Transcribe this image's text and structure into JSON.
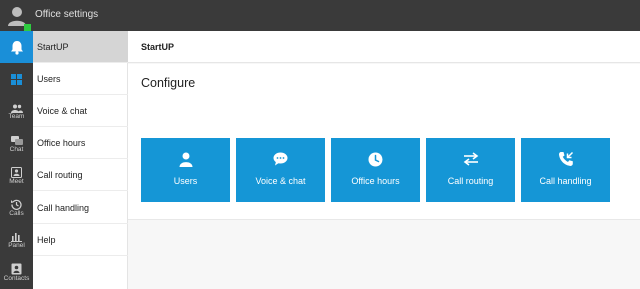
{
  "app": {
    "title": "Office settings"
  },
  "rail": [
    {
      "icon": "bell-icon",
      "label": ""
    },
    {
      "icon": "windows-icon",
      "label": ""
    },
    {
      "icon": "team-icon",
      "label": "Team"
    },
    {
      "icon": "chat-icon",
      "label": "Chat"
    },
    {
      "icon": "meet-icon",
      "label": "Meet"
    },
    {
      "icon": "calls-icon",
      "label": "Calls"
    },
    {
      "icon": "panel-icon",
      "label": "Panel"
    },
    {
      "icon": "contacts-icon",
      "label": "Contacts"
    }
  ],
  "menu": [
    {
      "label": "StartUP"
    },
    {
      "label": "Users"
    },
    {
      "label": "Voice & chat"
    },
    {
      "label": "Office hours"
    },
    {
      "label": "Call routing"
    },
    {
      "label": "Call handling"
    },
    {
      "label": "Help"
    }
  ],
  "header": {
    "title": "StartUP"
  },
  "configure": {
    "title": "Configure",
    "tiles": [
      {
        "label": "Users",
        "icon": "user-icon"
      },
      {
        "label": "Voice & chat",
        "icon": "chat-bubble-icon"
      },
      {
        "label": "Office hours",
        "icon": "clock-icon"
      },
      {
        "label": "Call routing",
        "icon": "swap-arrows-icon"
      },
      {
        "label": "Call handling",
        "icon": "incoming-call-icon"
      }
    ]
  },
  "colors": {
    "accent": "#1596d6",
    "rail_active": "#1a8fd8",
    "dark": "#3a3a3a",
    "status": "#2ecc40"
  }
}
